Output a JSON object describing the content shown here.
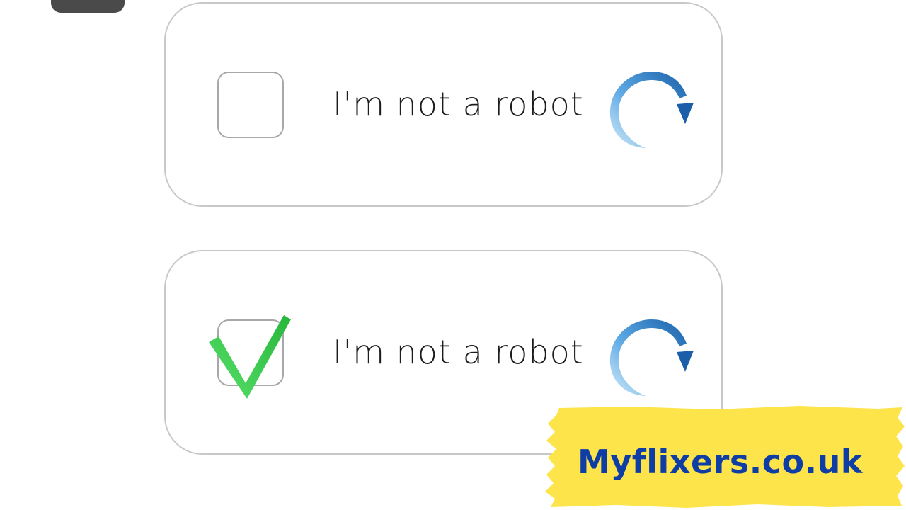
{
  "captchas": [
    {
      "label": "I'm not a robot",
      "checked": false
    },
    {
      "label": "I'm not a robot",
      "checked": true
    }
  ],
  "brand": {
    "text": "Myflixers.co.uk",
    "text_color": "#0d3da5",
    "banner_color": "#fde44a"
  },
  "icons": {
    "refresh": "refresh-icon",
    "checkmark": "checkmark-icon"
  },
  "colors": {
    "refresh_blue": "#1e6bb8",
    "check_green": "#3fcf4f",
    "card_border": "#c8c8c8"
  }
}
